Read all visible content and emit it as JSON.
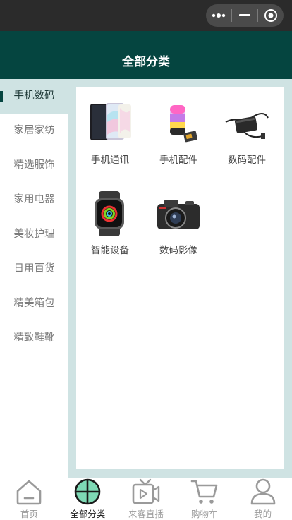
{
  "header": {
    "title": "全部分类"
  },
  "sidebar": {
    "items": [
      {
        "label": "手机数码"
      },
      {
        "label": "家居家纺"
      },
      {
        "label": "精选服饰"
      },
      {
        "label": "家用电器"
      },
      {
        "label": "美妆护理"
      },
      {
        "label": "日用百货"
      },
      {
        "label": "精美箱包"
      },
      {
        "label": "精致鞋靴"
      }
    ],
    "active_index": 0
  },
  "products": [
    {
      "label": "手机通讯",
      "icon": "smartphone-image"
    },
    {
      "label": "手机配件",
      "icon": "speaker-image"
    },
    {
      "label": "数码配件",
      "icon": "power-adapter-image"
    },
    {
      "label": "智能设备",
      "icon": "smartwatch-image"
    },
    {
      "label": "数码影像",
      "icon": "camera-image"
    }
  ],
  "tabbar": {
    "items": [
      {
        "label": "首页",
        "icon": "home-icon"
      },
      {
        "label": "全部分类",
        "icon": "category-icon"
      },
      {
        "label": "来客直播",
        "icon": "live-video-icon"
      },
      {
        "label": "购物车",
        "icon": "cart-icon"
      },
      {
        "label": "我的",
        "icon": "user-icon"
      }
    ],
    "active_index": 1
  },
  "colors": {
    "brand": "#054540",
    "accent": "#cfe3e3",
    "active_icon_fill": "#7ed9b5"
  }
}
